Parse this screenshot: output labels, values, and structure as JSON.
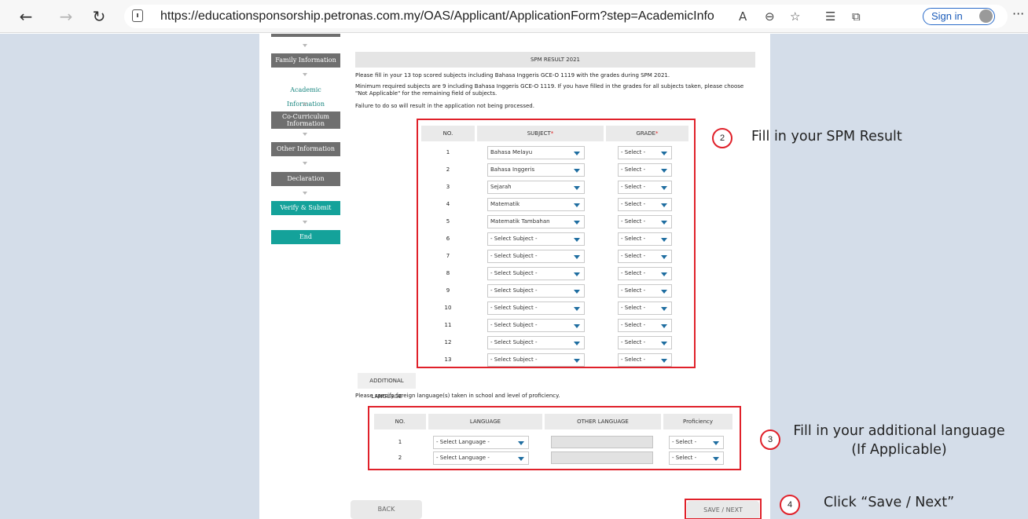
{
  "browser": {
    "url": "https://educationsponsorship.petronas.com.my/OAS/Applicant/ApplicationForm?step=AcademicInfo",
    "sign_in": "Sign in"
  },
  "sidebar": {
    "steps": [
      "Family Information",
      "Academic Information",
      "Co-Curriculum Information",
      "Other Information",
      "Declaration",
      "Verify & Submit",
      "End"
    ]
  },
  "spm": {
    "title": "SPM RESULT 2021",
    "note1": "Please fill in your 13 top scored subjects including Bahasa Inggeris GCE-O 1119 with the grades during SPM 2021.",
    "note2": "Minimum required subjects are 9 including Bahasa Inggeris GCE-O 1119. If you have filled in the grades for all subjects taken, please choose \"Not Applicable\" for the remaining field of subjects.",
    "note3": "Failure to do so will result in the application not being processed.",
    "col_no": "NO.",
    "col_subject": "SUBJECT",
    "col_grade": "GRADE",
    "required_mark": "*",
    "rows": [
      {
        "no": "1",
        "subject": "Bahasa Melayu",
        "grade": "- Select -"
      },
      {
        "no": "2",
        "subject": "Bahasa Inggeris",
        "grade": "- Select -"
      },
      {
        "no": "3",
        "subject": "Sejarah",
        "grade": "- Select -"
      },
      {
        "no": "4",
        "subject": "Matematik",
        "grade": "- Select -"
      },
      {
        "no": "5",
        "subject": "Matematik Tambahan",
        "grade": "- Select -"
      },
      {
        "no": "6",
        "subject": "- Select Subject -",
        "grade": "- Select -"
      },
      {
        "no": "7",
        "subject": "- Select Subject -",
        "grade": "- Select -"
      },
      {
        "no": "8",
        "subject": "- Select Subject -",
        "grade": "- Select -"
      },
      {
        "no": "9",
        "subject": "- Select Subject -",
        "grade": "- Select -"
      },
      {
        "no": "10",
        "subject": "- Select Subject -",
        "grade": "- Select -"
      },
      {
        "no": "11",
        "subject": "- Select Subject -",
        "grade": "- Select -"
      },
      {
        "no": "12",
        "subject": "- Select Subject -",
        "grade": "- Select -"
      },
      {
        "no": "13",
        "subject": "- Select Subject -",
        "grade": "- Select -"
      }
    ]
  },
  "additional_language": {
    "title": "ADDITIONAL LANGUAGE",
    "note": "Please specify foreign language(s) taken in school and level of proficiency.",
    "col_no": "NO.",
    "col_language": "LANGUAGE",
    "col_other": "OTHER LANGUAGE",
    "col_proficiency": "Proficiency",
    "rows": [
      {
        "no": "1",
        "language": "- Select Language -",
        "other": "",
        "proficiency": "- Select -"
      },
      {
        "no": "2",
        "language": "- Select Language -",
        "other": "",
        "proficiency": "- Select -"
      }
    ]
  },
  "buttons": {
    "back": "BACK",
    "save_next": "SAVE / NEXT"
  },
  "callouts": [
    {
      "num": "2",
      "text": "Fill in your SPM Result"
    },
    {
      "num": "3",
      "text": "Fill in your additional language (If Applicable)"
    },
    {
      "num": "4",
      "text": "Click “Save / Next”"
    }
  ],
  "colors": {
    "accent_teal": "#14a29a",
    "annotation_red": "#e0212a",
    "side_bg": "#d4dde9",
    "step_grey": "#6f6f6f"
  }
}
